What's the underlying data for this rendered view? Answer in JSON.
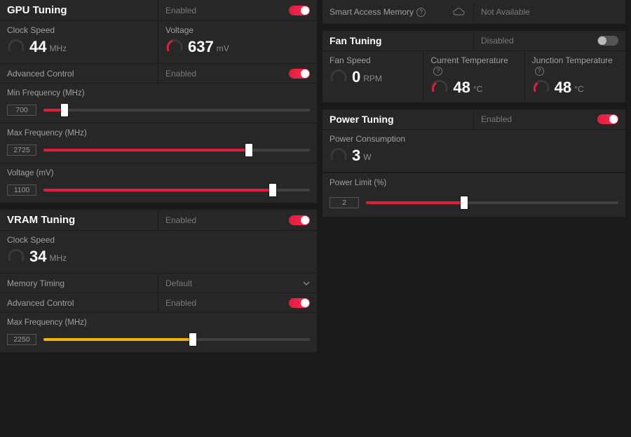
{
  "gpu": {
    "title": "GPU Tuning",
    "state_label": "Enabled",
    "clock": {
      "label": "Clock Speed",
      "value": "44",
      "unit": "MHz"
    },
    "voltage": {
      "label": "Voltage",
      "value": "637",
      "unit": "mV"
    },
    "adv_label": "Advanced Control",
    "adv_state": "Enabled",
    "min_freq": {
      "label": "Min Frequency (MHz)",
      "value": "700",
      "pct": 8
    },
    "max_freq": {
      "label": "Max Frequency (MHz)",
      "value": "2725",
      "pct": 77
    },
    "voltage_slider": {
      "label": "Voltage (mV)",
      "value": "1100",
      "pct": 86
    }
  },
  "vram": {
    "title": "VRAM Tuning",
    "state_label": "Enabled",
    "clock": {
      "label": "Clock Speed",
      "value": "34",
      "unit": "MHz"
    },
    "mem_timing_label": "Memory Timing",
    "mem_timing_value": "Default",
    "adv_label": "Advanced Control",
    "adv_state": "Enabled",
    "max_freq": {
      "label": "Max Frequency (MHz)",
      "value": "2250",
      "pct": 56
    }
  },
  "sam": {
    "label": "Smart Access Memory",
    "status": "Not Available"
  },
  "fan": {
    "title": "Fan Tuning",
    "state_label": "Disabled",
    "speed": {
      "label": "Fan Speed",
      "value": "0",
      "unit": "RPM"
    },
    "cur_temp": {
      "label": "Current Temperature",
      "value": "48",
      "unit": "°C"
    },
    "jun_temp": {
      "label": "Junction Temperature",
      "value": "48",
      "unit": "°C"
    }
  },
  "power": {
    "title": "Power Tuning",
    "state_label": "Enabled",
    "consumption": {
      "label": "Power Consumption",
      "value": "3",
      "unit": "W"
    },
    "limit": {
      "label": "Power Limit (%)",
      "value": "2",
      "pct": 39
    }
  }
}
